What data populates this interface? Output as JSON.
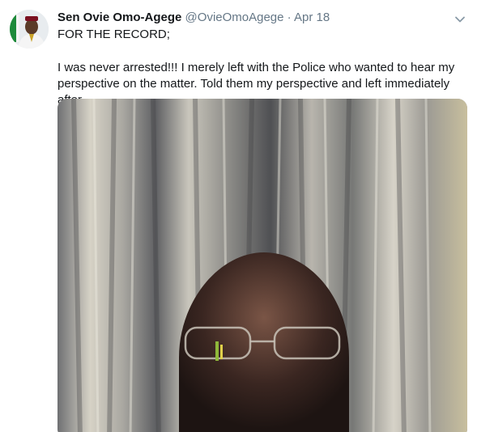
{
  "tweet": {
    "author_name": "Sen Ovie Omo-Agege",
    "handle": "@OvieOmoAgege",
    "separator": "·",
    "date": "Apr 18",
    "paragraph_1": "FOR THE RECORD;",
    "paragraph_2": "I was never arrested!!! I merely left with the Police who wanted to hear my perspective on the matter. Told them my perspective and left immediately after."
  },
  "icons": {
    "menu": "chevron-down-icon"
  },
  "colors": {
    "name": "#14171a",
    "secondary": "#657786",
    "background": "#ffffff"
  }
}
